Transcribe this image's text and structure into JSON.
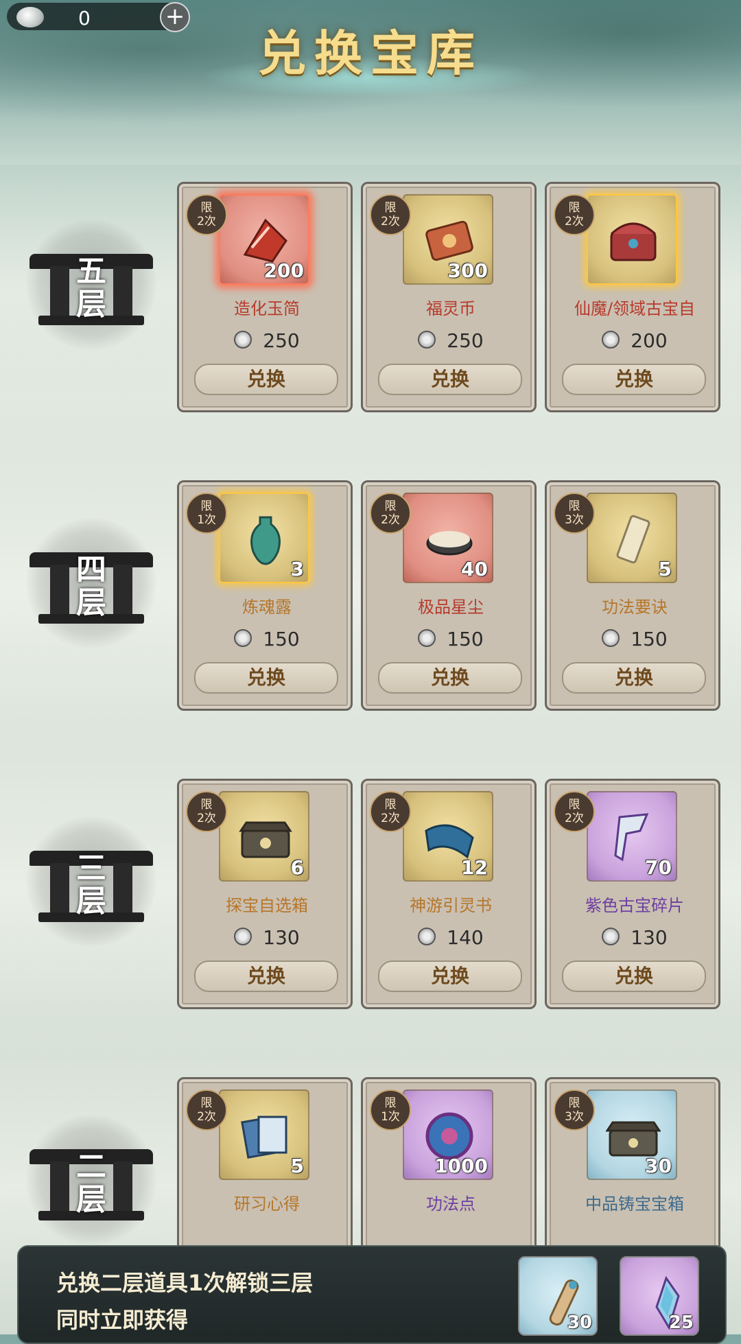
{
  "header": {
    "title": "兑换宝库",
    "currency_value": "0",
    "add_label": "+"
  },
  "redeem_label": "兑换",
  "tiers": [
    {
      "label_line1": "五",
      "label_line2": "层",
      "items": [
        {
          "name": "造化玉简",
          "quantity": "200",
          "price": "250",
          "limit_line1": "限",
          "limit_line2": "2次",
          "frame": "red",
          "name_color": "red",
          "glow": "red",
          "art": "crimson-jade-slip-icon"
        },
        {
          "name": "福灵币",
          "quantity": "300",
          "price": "250",
          "limit_line1": "限",
          "limit_line2": "2次",
          "frame": "gold",
          "name_color": "red",
          "glow": "",
          "art": "fortune-coin-icon"
        },
        {
          "name": "仙魔/领域古宝自",
          "quantity": "",
          "price": "200",
          "limit_line1": "限",
          "limit_line2": "2次",
          "frame": "gold",
          "name_color": "red",
          "glow": "gold",
          "art": "treasure-chest-icon"
        }
      ]
    },
    {
      "label_line1": "四",
      "label_line2": "层",
      "items": [
        {
          "name": "炼魂露",
          "quantity": "3",
          "price": "150",
          "limit_line1": "限",
          "limit_line2": "1次",
          "frame": "gold",
          "name_color": "orange",
          "glow": "gold",
          "art": "soul-vase-icon"
        },
        {
          "name": "极品星尘",
          "quantity": "40",
          "price": "150",
          "limit_line1": "限",
          "limit_line2": "2次",
          "frame": "red",
          "name_color": "red",
          "glow": "",
          "art": "stardust-icon"
        },
        {
          "name": "功法要诀",
          "quantity": "5",
          "price": "150",
          "limit_line1": "限",
          "limit_line2": "3次",
          "frame": "gold",
          "name_color": "orange",
          "glow": "",
          "art": "scroll-icon"
        }
      ]
    },
    {
      "label_line1": "三",
      "label_line2": "层",
      "items": [
        {
          "name": "探宝自选箱",
          "quantity": "6",
          "price": "130",
          "limit_line1": "限",
          "limit_line2": "2次",
          "frame": "gold",
          "name_color": "orange",
          "glow": "",
          "art": "selection-chest-icon"
        },
        {
          "name": "神游引灵书",
          "quantity": "12",
          "price": "140",
          "limit_line1": "限",
          "limit_line2": "2次",
          "frame": "gold",
          "name_color": "orange",
          "glow": "",
          "art": "spirit-book-icon"
        },
        {
          "name": "紫色古宝碎片",
          "quantity": "70",
          "price": "130",
          "limit_line1": "限",
          "limit_line2": "2次",
          "frame": "purple",
          "name_color": "purple",
          "glow": "",
          "art": "purple-fragment-icon"
        }
      ]
    },
    {
      "label_line1": "二",
      "label_line2": "层",
      "items": [
        {
          "name": "研习心得",
          "quantity": "5",
          "price": "",
          "limit_line1": "限",
          "limit_line2": "2次",
          "frame": "gold",
          "name_color": "orange",
          "glow": "",
          "art": "study-notes-icon"
        },
        {
          "name": "功法点",
          "quantity": "1000",
          "price": "",
          "limit_line1": "限",
          "limit_line2": "1次",
          "frame": "purple",
          "name_color": "purple",
          "glow": "",
          "art": "skill-point-orb-icon"
        },
        {
          "name": "中品铸宝宝箱",
          "quantity": "30",
          "price": "",
          "limit_line1": "限",
          "limit_line2": "3次",
          "frame": "blue",
          "name_color": "blue",
          "glow": "",
          "art": "forge-chest-icon"
        }
      ]
    }
  ],
  "footer": {
    "line1": "兑换二层道具1次解锁三层",
    "line2": "同时立即获得",
    "rewards": [
      {
        "quantity": "30",
        "frame": "blue",
        "art": "blue-scroll-icon"
      },
      {
        "quantity": "25",
        "frame": "purple",
        "art": "purple-crystal-icon"
      }
    ]
  }
}
